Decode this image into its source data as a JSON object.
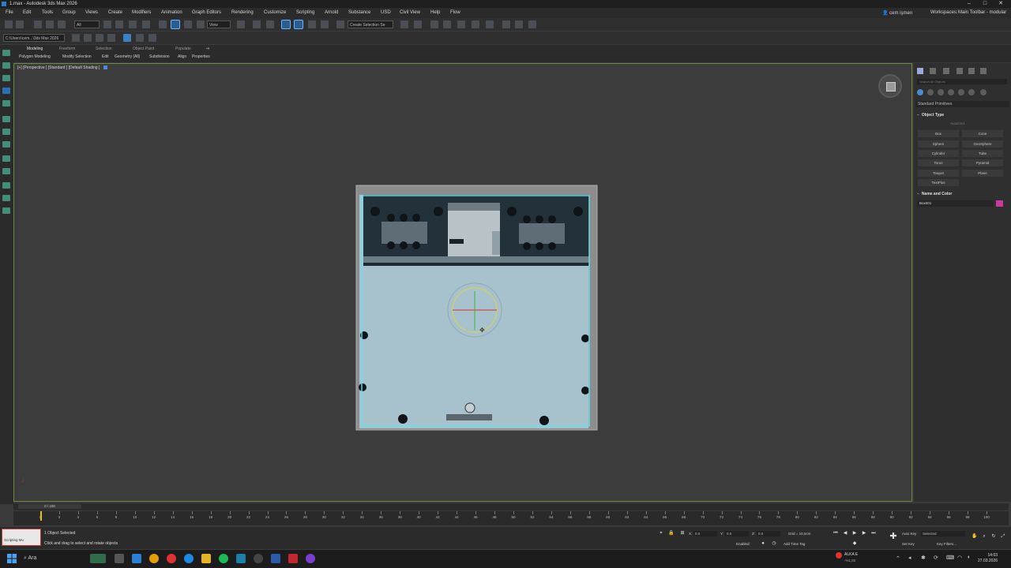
{
  "window": {
    "title": "1.max - Autodesk 3ds Max 2026",
    "min": "–",
    "max": "□",
    "close": "✕"
  },
  "menubar": {
    "items": [
      "File",
      "Edit",
      "Tools",
      "Group",
      "Views",
      "Create",
      "Modifiers",
      "Animation",
      "Graph Editors",
      "Rendering",
      "Customize",
      "Scripting",
      "Arnold",
      "Substance",
      "USD",
      "Civil View",
      "Help",
      "Flow"
    ],
    "user": "cem işmen",
    "workspaces_label": "Workspaces:",
    "workspace": "Main Toolbar - modular"
  },
  "toolbar": {
    "filter": "All",
    "ref_coord": "View",
    "selection_set": "Create Selection Se",
    "project_path": "C:\\Users\\cem...\\3ds Max 2026"
  },
  "ribbon": {
    "tabs": [
      "Modeling",
      "Freeform",
      "Selection",
      "Object Paint",
      "Populate"
    ],
    "items": [
      "Polygon Modeling",
      "Modify Selection",
      "Edit",
      "Geometry (All)",
      "Subdivision",
      "Align",
      "Properties"
    ]
  },
  "viewport": {
    "label": "[+] [Perspective ] [Standard ] [Default Shading ]"
  },
  "command_panel": {
    "search_placeholder": "Search All Objects",
    "category": "Standard Primitives",
    "object_type_title": "Object Type",
    "autogrid": "AutoGrid",
    "buttons": [
      "Box",
      "Cone",
      "Sphere",
      "GeoSphere",
      "Cylinder",
      "Tube",
      "Torus",
      "Pyramid",
      "Teapot",
      "Plane",
      "TextPlus"
    ],
    "name_color_title": "Name and Color",
    "object_name": "Box001",
    "object_color": "#c63a9e"
  },
  "timeline": {
    "slider_label": "0 / 100",
    "ticks": [
      "0",
      "2",
      "4",
      "6",
      "8",
      "10",
      "12",
      "14",
      "16",
      "18",
      "20",
      "22",
      "24",
      "26",
      "28",
      "30",
      "32",
      "34",
      "36",
      "38",
      "40",
      "42",
      "44",
      "46",
      "48",
      "50",
      "52",
      "54",
      "56",
      "58",
      "60",
      "62",
      "64",
      "66",
      "68",
      "70",
      "72",
      "74",
      "76",
      "78",
      "80",
      "82",
      "84",
      "86",
      "88",
      "90",
      "92",
      "94",
      "96",
      "98",
      "100"
    ]
  },
  "status": {
    "line1": "1 Object Selected",
    "line2": "Click and drag to select and rotate objects",
    "x_label": "X:",
    "x_value": "0.0",
    "y_label": "Y:",
    "y_value": "0.0",
    "z_label": "Z:",
    "z_value": "0.0",
    "grid": "Grid = 10,0cm",
    "enabled": "Enabled:",
    "add_time_tag": "Add Time Tag",
    "auto_key": "Auto Key",
    "set_key": "Set Key",
    "selected": "Selected",
    "key_filters": "Key Filters...",
    "maxscript": "Scripting Mu"
  },
  "taskbar": {
    "search": "Ara",
    "weather_label": "ALKA E",
    "weather_sub": "-%1,92",
    "time": "14:03",
    "date": "27.03.2026"
  }
}
